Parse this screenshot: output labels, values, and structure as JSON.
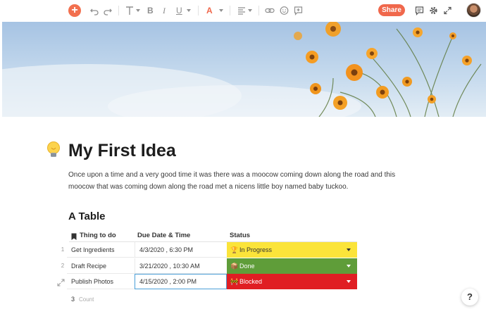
{
  "toolbar": {
    "add_icon": "plus-circle-icon",
    "undo_icon": "undo-icon",
    "redo_icon": "redo-icon",
    "text_style_icon": "text-style-icon",
    "bold": "B",
    "italic": "I",
    "underline": "U",
    "text_color": "A",
    "text_color_hex": "#f0684c",
    "align_icon": "align-left-icon",
    "link_icon": "link-icon",
    "emoji_icon": "emoji-icon",
    "comment_add_icon": "add-comment-icon",
    "share_label": "Share",
    "comments_icon": "comments-icon",
    "settings_icon": "gear-icon",
    "fullscreen_icon": "expand-icon",
    "accent": "#f0684c"
  },
  "cover": {
    "description_icon": "cover-image-flowers"
  },
  "page": {
    "emoji": "lightbulb-icon",
    "title": "My First Idea",
    "paragraph": "Once upon a time and a very good time it was there was a moocow coming down along the road and this moocow that was coming down along the road met a nicens little boy named baby tuckoo.",
    "section_title": "A Table"
  },
  "table": {
    "headers": {
      "thing": "Thing to do",
      "due": "Due Date & Time",
      "status": "Status"
    },
    "rows": [
      {
        "num": "1",
        "thing": "Get Ingredients",
        "due": "4/3/2020 , 6:30 PM",
        "status": "In Progress",
        "status_icon": "trophy-icon",
        "status_color": "#fbe43a"
      },
      {
        "num": "2",
        "thing": "Draft Recipe",
        "due": "3/21/2020 , 10:30 AM",
        "status": "Done",
        "status_icon": "box-icon",
        "status_color": "#5f9d39"
      },
      {
        "num": "",
        "thing": "Publish Photos",
        "due": "4/15/2020 , 2:00 PM",
        "status": "Blocked",
        "status_icon": "warning-icon",
        "status_color": "#e01e23"
      }
    ],
    "count_value": "3",
    "count_label": "Count"
  },
  "help": {
    "label": "?"
  }
}
